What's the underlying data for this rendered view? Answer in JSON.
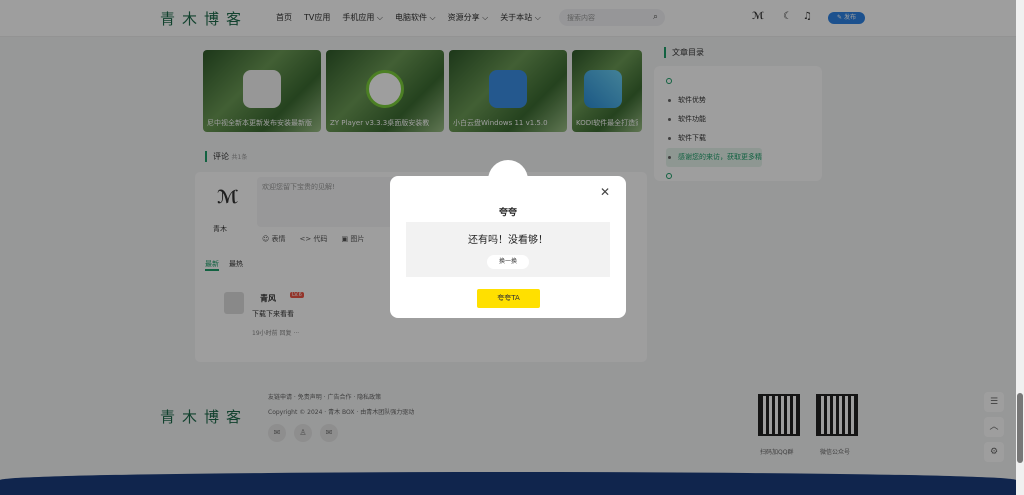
{
  "header": {
    "logo": "青木博客",
    "nav": [
      "首页",
      "TV应用",
      "手机应用 ⌵",
      "电脑软件 ⌵",
      "资源分享 ⌵",
      "关于本站 ⌵"
    ],
    "search_placeholder": "搜索内容",
    "post_label": "✎ 发布"
  },
  "cards": [
    {
      "title": "尼中视全新本更新发布安装最新版"
    },
    {
      "title": "ZY Player v3.3.3桌面版安装教"
    },
    {
      "title": "小白云盘Windows 11 v1.5.0"
    },
    {
      "title": "KODI软件最全打造家"
    }
  ],
  "toc": {
    "title": "文章目录",
    "items": [
      "软件优势",
      "软件功能",
      "软件下载",
      "感谢您的来访，获取更多精"
    ]
  },
  "comments": {
    "title": "评论",
    "count": "共1条",
    "placeholder": "欢迎您留下宝贵的见解!",
    "user": "青木",
    "tools": [
      "☺ 表情",
      "<> 代码",
      "▣ 图片"
    ],
    "tabs": [
      "最新",
      "最热"
    ],
    "item": {
      "name": "青风",
      "level": "LV.6",
      "text": "下载下来看看",
      "meta": "19小时前  回复  ···"
    }
  },
  "footer": {
    "logo": "青木博客",
    "links": "友链申请 · 免责声明 · 广告合作 · 隐私政策",
    "copyright": "Copyright © 2024 · 青木 BOX · 由青木团队强力驱动",
    "qr1": "扫码加QQ群",
    "qr2": "微信公众号"
  },
  "modal": {
    "title": "夸夸",
    "message": "还有吗！没看够！",
    "swap": "换一换",
    "action": "夸夸TA"
  }
}
